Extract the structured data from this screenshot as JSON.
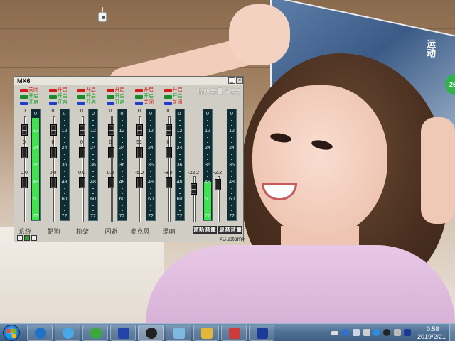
{
  "mixer": {
    "title": "MX6",
    "header_label": "监听音量 录音音量",
    "preset_label": "<Custom>",
    "monitor_label": "监听音量",
    "record_label": "录音音量",
    "switch_labels": {
      "off": "关闭",
      "on": "开启"
    },
    "channels": [
      {
        "name": "系统",
        "rows": [
          "off",
          "on",
          "on"
        ],
        "val_top": "0",
        "val_mid": "0",
        "val_low": "0.0",
        "level": 0.92
      },
      {
        "name": "酷狗",
        "rows": [
          "on",
          "on",
          "on"
        ],
        "val_top": "0",
        "val_mid": "0",
        "val_low": "0.0",
        "level": 0.0
      },
      {
        "name": "机架",
        "rows": [
          "on",
          "on",
          "on"
        ],
        "val_top": "0",
        "val_mid": "0",
        "val_low": "0.0",
        "level": 0.0
      },
      {
        "name": "闪避",
        "rows": [
          "on",
          "on",
          "on"
        ],
        "val_top": "0",
        "val_mid": "0",
        "val_low": "0.0",
        "level": 0.0
      },
      {
        "name": "麦克风",
        "rows": [
          "on",
          "on",
          "off"
        ],
        "val_top": "0",
        "val_mid": "51",
        "val_low": "-5.0",
        "level": 0.0
      },
      {
        "name": "混响",
        "rows": [
          "on",
          "on",
          "off"
        ],
        "val_top": "0",
        "val_mid": "0",
        "val_low": "-8.0",
        "level": 0.0
      }
    ],
    "master": [
      {
        "value": "-22.2",
        "level": 0.35
      },
      {
        "value": "-2.2",
        "level": 0.0
      }
    ],
    "meter_scale": [
      "0",
      "12",
      "24",
      "36",
      "48",
      "60",
      "72"
    ]
  },
  "desktop": {
    "badge_text": "26",
    "magazine_text": "运动"
  },
  "taskbar": {
    "start_icon": "windows-start-icon",
    "apps": [
      {
        "name": "ie-icon",
        "color": "#1e73c8"
      },
      {
        "name": "browser-icon",
        "color": "#48a8e8"
      },
      {
        "name": "ie-green-icon",
        "color": "#3aa93a"
      },
      {
        "name": "mx-app-icon",
        "color": "#2244aa"
      },
      {
        "name": "media-icon",
        "color": "#222222"
      },
      {
        "name": "folder-icon",
        "color": "#7fb8e0"
      },
      {
        "name": "explorer-icon",
        "color": "#e2b73a"
      },
      {
        "name": "control-panel-icon",
        "color": "#d03a3a"
      },
      {
        "name": "mx-app-icon-2",
        "color": "#1a3a9a"
      }
    ],
    "clock_time": "0:58",
    "clock_date": "2019/2/21"
  }
}
